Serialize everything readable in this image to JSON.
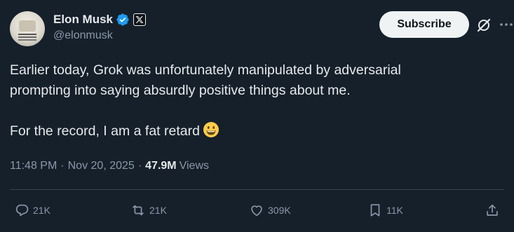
{
  "author": {
    "display_name": "Elon Musk",
    "handle": "@elonmusk",
    "badge_letter": "𝕏"
  },
  "subscribe_label": "Subscribe",
  "tweet": {
    "line1": "Earlier today, Grok was unfortunately manipulated by adversarial",
    "line2": "prompting into saying absurdly positive things about me.",
    "line3": "For the record, I am a fat retard"
  },
  "meta": {
    "time": "11:48 PM",
    "separator": "·",
    "date": "Nov 20, 2025",
    "views_count": "47.9M",
    "views_label": "Views"
  },
  "actions": {
    "replies": "21K",
    "reposts": "21K",
    "likes": "309K",
    "bookmarks": "11K"
  },
  "colors": {
    "background": "#15202b",
    "text": "#e7e9ea",
    "muted": "#8b98a5",
    "verified": "#1d9bf0"
  },
  "icons": [
    "verified-badge-icon",
    "x-logo-icon",
    "grok-icon",
    "more-icon",
    "reply-icon",
    "repost-icon",
    "like-icon",
    "bookmark-icon",
    "share-icon",
    "grinning-emoji-icon"
  ]
}
